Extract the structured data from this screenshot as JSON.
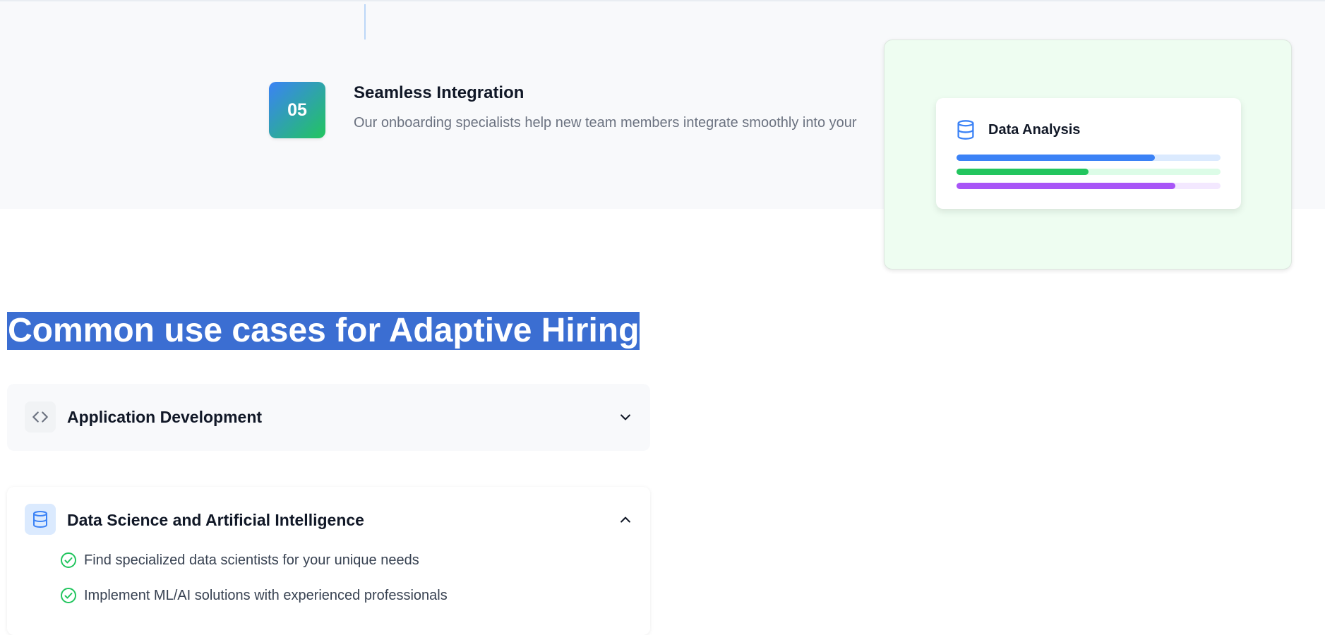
{
  "step": {
    "number": "05",
    "title": "Seamless Integration",
    "description": "Our onboarding specialists help new team members integrate smoothly into your"
  },
  "preview": {
    "card_title": "Data Analysis",
    "icon": "database-icon",
    "bars": [
      {
        "fill": 0.75,
        "color": "#3b82f6",
        "track": "#dbeafe"
      },
      {
        "fill": 0.5,
        "color": "#22c55e",
        "track": "#dcfce7"
      },
      {
        "fill": 0.83,
        "color": "#a855f7",
        "track": "#f3e8ff"
      }
    ]
  },
  "use_cases": {
    "heading": "Common use cases for Adaptive Hiring",
    "items": [
      {
        "title": "Application Development",
        "icon": "code-icon",
        "expanded": false
      },
      {
        "title": "Data Science and Artificial Intelligence",
        "icon": "database-icon",
        "expanded": true,
        "features": [
          "Find specialized data scientists for your unique needs",
          "Implement ML/AI solutions with experienced professionals"
        ]
      }
    ]
  },
  "colors": {
    "accent_blue": "#3b82f6",
    "accent_green": "#22c55e",
    "selection": "#3b6ed2"
  }
}
